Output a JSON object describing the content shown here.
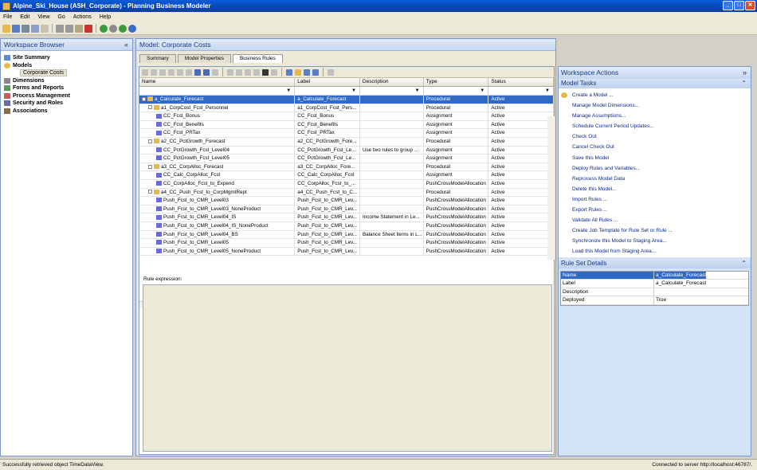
{
  "window": {
    "title": "Alpine_Ski_House (ASH_Corporate) - Planning Business Modeler"
  },
  "menu": [
    "File",
    "Edit",
    "View",
    "Go",
    "Actions",
    "Help"
  ],
  "workspace_browser": {
    "title": "Workspace Browser",
    "items": [
      {
        "label": "Site Summary"
      },
      {
        "label": "Models"
      },
      {
        "label": "Corporate Costs",
        "selected": true
      },
      {
        "label": "Dimensions"
      },
      {
        "label": "Forms and Reports"
      },
      {
        "label": "Process Management"
      },
      {
        "label": "Security and Roles"
      },
      {
        "label": "Associations"
      }
    ]
  },
  "model": {
    "title": "Model: Corporate Costs",
    "tabs": [
      "Summary",
      "Model Properties",
      "Business Rules"
    ],
    "active_tab": "Business Rules"
  },
  "grid": {
    "columns": [
      "Name",
      "Label",
      "Description",
      "Type",
      "Status"
    ],
    "rows": [
      {
        "name": "a_Calculate_Forecast",
        "label": "a_Calculate_Forecast",
        "description": "",
        "type": "Procedural",
        "status": "Active",
        "level": 0,
        "kind": "set",
        "selected": true
      },
      {
        "name": "a1_CorpCost_Fcst_Personnel",
        "label": "a1_CorpCost_Fcst_Pers...",
        "description": "",
        "type": "Procedural",
        "status": "Active",
        "level": 1,
        "kind": "set"
      },
      {
        "name": "CC_Fcst_Bonus",
        "label": "CC_Fcst_Bonus",
        "description": "",
        "type": "Assignment",
        "status": "Active",
        "level": 2,
        "kind": "rule"
      },
      {
        "name": "CC_Fcst_Benefits",
        "label": "CC_Fcst_Benefits",
        "description": "",
        "type": "Assignment",
        "status": "Active",
        "level": 2,
        "kind": "rule"
      },
      {
        "name": "CC_Fcst_PRTax",
        "label": "CC_Fcst_PRTax",
        "description": "",
        "type": "Assignment",
        "status": "Active",
        "level": 2,
        "kind": "rule"
      },
      {
        "name": "a2_CC_PctGrowth_Forecast",
        "label": "a2_CC_PctGrowth_Fore...",
        "description": "",
        "type": "Procedural",
        "status": "Active",
        "level": 1,
        "kind": "set"
      },
      {
        "name": "CC_PctGrowth_Fcst_Level04",
        "label": "CC_PctGrowth_Fcst_Le...",
        "description": "Use two rules to group ...",
        "type": "Assignment",
        "status": "Active",
        "level": 2,
        "kind": "rule"
      },
      {
        "name": "CC_PctGrowth_Fcst_Level05",
        "label": "CC_PctGrowth_Fcst_Le...",
        "description": "",
        "type": "Assignment",
        "status": "Active",
        "level": 2,
        "kind": "rule"
      },
      {
        "name": "a3_CC_CorpAlloc_Forecast",
        "label": "a3_CC_CorpAlloc_Fore...",
        "description": "",
        "type": "Procedural",
        "status": "Active",
        "level": 1,
        "kind": "set"
      },
      {
        "name": "CC_Calc_CorpAlloc_Fcst",
        "label": "CC_Calc_CorpAlloc_Fcst",
        "description": "",
        "type": "Assignment",
        "status": "Active",
        "level": 2,
        "kind": "rule"
      },
      {
        "name": "CC_CorpAlloc_Fcst_to_Expend",
        "label": "CC_CorpAlloc_Fcst_to_...",
        "description": "",
        "type": "PushCrossModelAllocation",
        "status": "Active",
        "level": 2,
        "kind": "rule"
      },
      {
        "name": "a4_CC_Push_Fcst_to_CorpMgmtRept",
        "label": "a4_CC_Push_Fcst_to_C...",
        "description": "",
        "type": "Procedural",
        "status": "Active",
        "level": 1,
        "kind": "set"
      },
      {
        "name": "Push_Fcst_to_CMR_Level03",
        "label": "Push_Fcst_to_CMR_Lev...",
        "description": "",
        "type": "PushCrossModelAllocation",
        "status": "Active",
        "level": 2,
        "kind": "rule"
      },
      {
        "name": "Push_Fcst_to_CMR_Level03_NoneProduct",
        "label": "Push_Fcst_to_CMR_Lev...",
        "description": "",
        "type": "PushCrossModelAllocation",
        "status": "Active",
        "level": 2,
        "kind": "rule"
      },
      {
        "name": "Push_Fcst_to_CMR_Level04_IS",
        "label": "Push_Fcst_to_CMR_Lev...",
        "description": "Income Statement in Le...",
        "type": "PushCrossModelAllocation",
        "status": "Active",
        "level": 2,
        "kind": "rule"
      },
      {
        "name": "Push_Fcst_to_CMR_Level04_IS_NoneProduct",
        "label": "Push_Fcst_to_CMR_Lev...",
        "description": "",
        "type": "PushCrossModelAllocation",
        "status": "Active",
        "level": 2,
        "kind": "rule"
      },
      {
        "name": "Push_Fcst_to_CMR_Level04_BS",
        "label": "Push_Fcst_to_CMR_Lev...",
        "description": "Balance Sheet items in L...",
        "type": "PushCrossModelAllocation",
        "status": "Active",
        "level": 2,
        "kind": "rule"
      },
      {
        "name": "Push_Fcst_to_CMR_Level05",
        "label": "Push_Fcst_to_CMR_Lev...",
        "description": "",
        "type": "PushCrossModelAllocation",
        "status": "Active",
        "level": 2,
        "kind": "rule"
      },
      {
        "name": "Push_Fcst_to_CMR_Level05_NoneProduct",
        "label": "Push_Fcst_to_CMR_Lev...",
        "description": "",
        "type": "PushCrossModelAllocation",
        "status": "Active",
        "level": 2,
        "kind": "rule"
      }
    ]
  },
  "rule_expression": {
    "label": "Rule expression:"
  },
  "workspace_actions": {
    "title": "Workspace Actions",
    "model_tasks_title": "Model Tasks",
    "tasks": [
      "Create a Model ...",
      "Manage Model Dimensions...",
      "Manage Assumptions...",
      "Schedule Current Period Updates...",
      "Check Out",
      "Cancel Check Out",
      "Save this Model",
      "Deploy Rules and Variables...",
      "Reprocess Model Data",
      "Delete this Model...",
      "Import Rules ...",
      "Export Rules ...",
      "Validate All Rules ...",
      "Create Job Template for Rule Set or Rule ...",
      "Synchronize this Model to Staging Area...",
      "Load this Model from Staging Area..."
    ],
    "rule_set_details_title": "Rule Set Details",
    "details": [
      {
        "key": "Name",
        "value": "a_Calculate_Forecast"
      },
      {
        "key": "Label",
        "value": "a_Calculate_Forecast"
      },
      {
        "key": "Description",
        "value": ""
      },
      {
        "key": "Deployed",
        "value": "True"
      }
    ]
  },
  "status": {
    "left": "Successfully retrieved object TimeDataView.",
    "right": "Connected to server http://localhost:46787/."
  }
}
